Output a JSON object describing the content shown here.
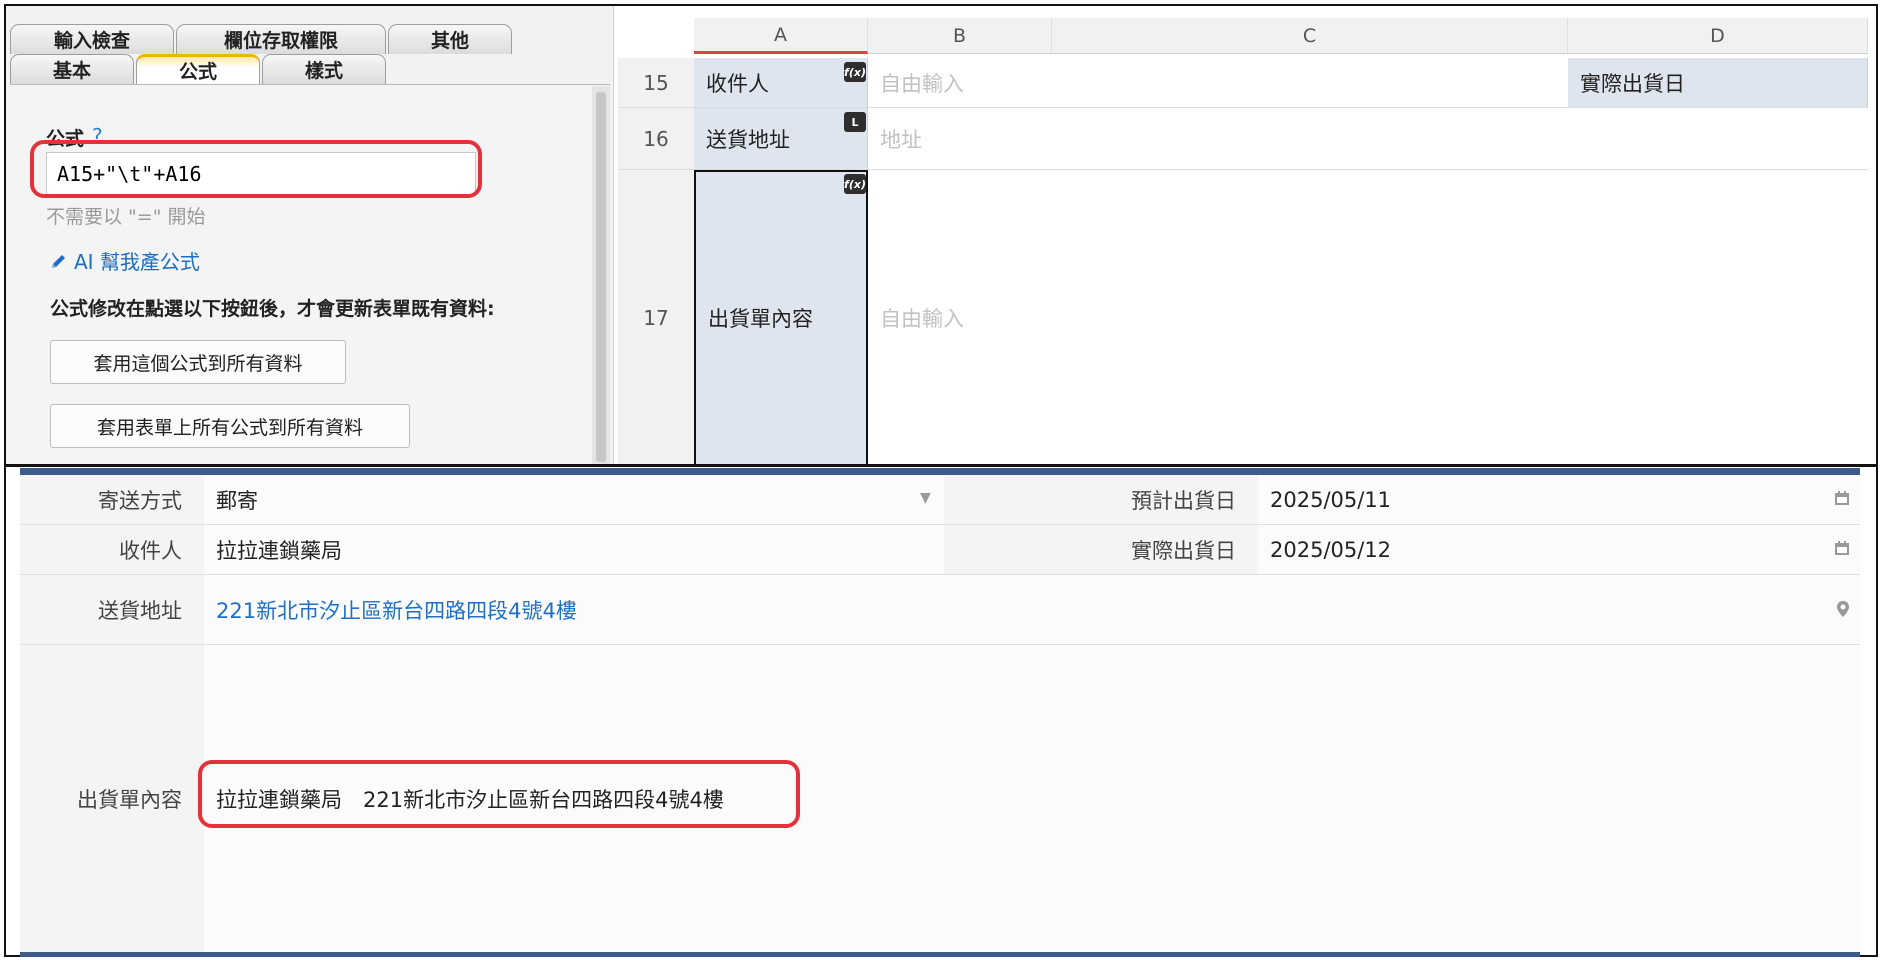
{
  "settings": {
    "tabs_back": [
      "輸入檢查",
      "欄位存取權限",
      "其他"
    ],
    "tabs_front": [
      "基本",
      "公式",
      "樣式"
    ],
    "active_tab": "公式",
    "formula_label": "公式",
    "formula_help": "?",
    "formula_value": "A15+\"\\t\"+A16",
    "formula_hint": "不需要以 \"=\" 開始",
    "ai_link": "AI 幫我產公式",
    "apply_note": "公式修改在點選以下按鈕後，才會更新表單既有資料:",
    "apply_one_button": "套用這個公式到所有資料",
    "apply_all_button": "套用表單上所有公式到所有資料"
  },
  "sheet": {
    "columns": [
      "A",
      "B",
      "C",
      "D"
    ],
    "rows": [
      {
        "num": "15",
        "a": "收件人",
        "badge": "f(x)",
        "b": "自由輸入",
        "d": "實際出貨日"
      },
      {
        "num": "16",
        "a": "送貨地址",
        "badge": "L",
        "b": "地址",
        "d": ""
      },
      {
        "num": "17",
        "a": "出貨單內容",
        "badge": "f(x)",
        "b": "自由輸入",
        "d": ""
      }
    ]
  },
  "form": {
    "ship_method_label": "寄送方式",
    "ship_method_value": "郵寄",
    "est_date_label": "預計出貨日",
    "est_date_value": "2025/05/11",
    "recipient_label": "收件人",
    "recipient_value": "拉拉連鎖藥局",
    "actual_date_label": "實際出貨日",
    "actual_date_value": "2025/05/12",
    "address_label": "送貨地址",
    "address_value": "221新北市汐止區新台四路四段4號4樓",
    "content_label": "出貨單內容",
    "content_value": "拉拉連鎖藥局　221新北市汐止區新台四路四段4號4樓"
  },
  "icons": {
    "dropdown": "caret-down-icon",
    "calendar": "calendar-icon",
    "location": "map-pin-icon",
    "edit": "pencil-icon"
  },
  "colors": {
    "highlight": "#e5313b",
    "link": "#1f6fc6",
    "form_bar": "#3c5a8a",
    "active_tab": "#f0b400"
  }
}
